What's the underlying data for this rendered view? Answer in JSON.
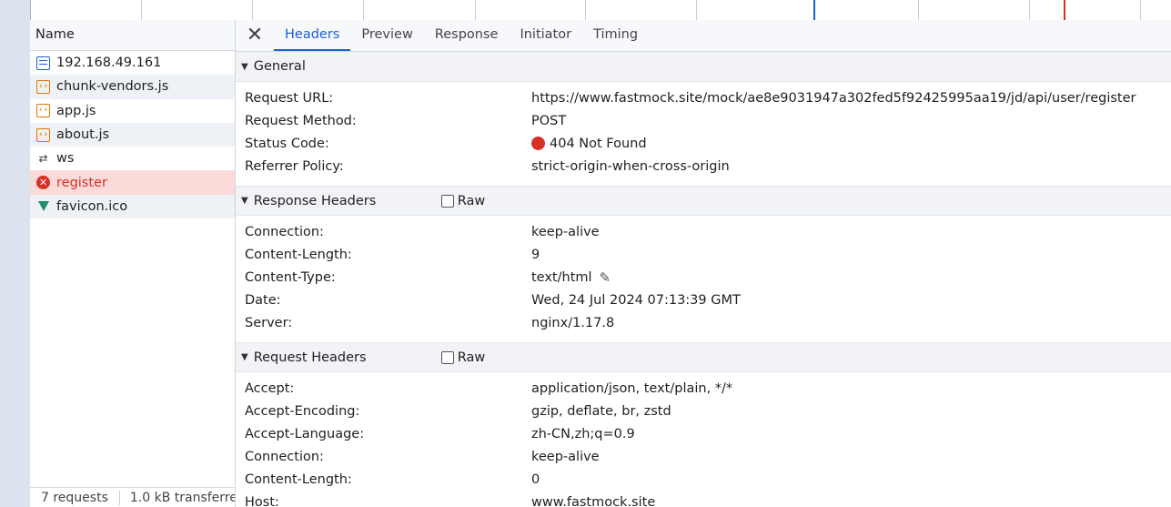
{
  "name_panel": {
    "header": "Name",
    "requests": [
      {
        "name": "192.168.49.161",
        "icon": "document-icon"
      },
      {
        "name": "chunk-vendors.js",
        "icon": "script-icon"
      },
      {
        "name": "app.js",
        "icon": "script-icon"
      },
      {
        "name": "about.js",
        "icon": "script-icon"
      },
      {
        "name": "ws",
        "icon": "websocket-icon"
      },
      {
        "name": "register",
        "icon": "error-icon"
      },
      {
        "name": "favicon.ico",
        "icon": "vue-icon"
      }
    ],
    "status": {
      "requests": "7 requests",
      "transferred": "1.0 kB transferre"
    }
  },
  "tabs": {
    "close": "✕",
    "headers": "Headers",
    "preview": "Preview",
    "response": "Response",
    "initiator": "Initiator",
    "timing": "Timing"
  },
  "general": {
    "title": "General",
    "rows": [
      {
        "k": "Request URL:",
        "v": "https://www.fastmock.site/mock/ae8e9031947a302fed5f92425995aa19/jd/api/user/register"
      },
      {
        "k": "Request Method:",
        "v": "POST"
      },
      {
        "k": "Status Code:",
        "v": "404 Not Found"
      },
      {
        "k": "Referrer Policy:",
        "v": "strict-origin-when-cross-origin"
      }
    ]
  },
  "response_headers": {
    "title": "Response Headers",
    "raw": "Raw",
    "rows": [
      {
        "k": "Connection:",
        "v": "keep-alive"
      },
      {
        "k": "Content-Length:",
        "v": "9"
      },
      {
        "k": "Content-Type:",
        "v": "text/html"
      },
      {
        "k": "Date:",
        "v": "Wed, 24 Jul 2024 07:13:39 GMT"
      },
      {
        "k": "Server:",
        "v": "nginx/1.17.8"
      }
    ]
  },
  "request_headers": {
    "title": "Request Headers",
    "raw": "Raw",
    "rows": [
      {
        "k": "Accept:",
        "v": "application/json, text/plain, */*"
      },
      {
        "k": "Accept-Encoding:",
        "v": "gzip, deflate, br, zstd"
      },
      {
        "k": "Accept-Language:",
        "v": "zh-CN,zh;q=0.9"
      },
      {
        "k": "Connection:",
        "v": "keep-alive"
      },
      {
        "k": "Content-Length:",
        "v": "0"
      },
      {
        "k": "Host:",
        "v": "www.fastmock.site"
      }
    ]
  },
  "colors": {
    "accent": "#1a5fd6",
    "error": "#d93025",
    "error_row_bg": "#fbdada"
  }
}
